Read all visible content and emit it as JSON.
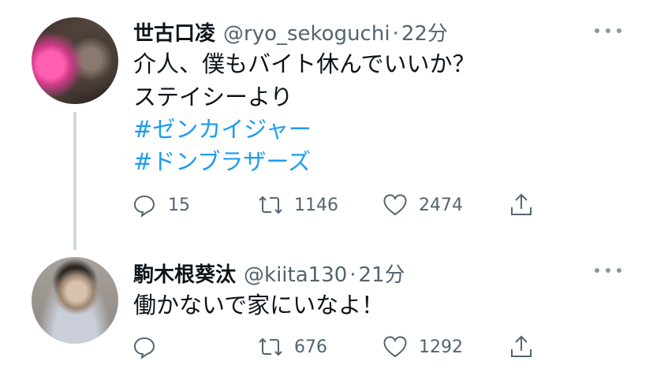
{
  "tweets": [
    {
      "name": "世古口凌",
      "handle": "@ryo_sekoguchi",
      "separator": "·",
      "time": "22分",
      "lines": [
        "介人、僕もバイト休んでいいか？",
        "ステイシーより"
      ],
      "hashtags": [
        "#ゼンカイジャー",
        "#ドンブラザーズ"
      ],
      "reply_count": "15",
      "retweet_count": "1146",
      "like_count": "2474"
    },
    {
      "name": "駒木根葵汰",
      "handle": "@kiita130",
      "separator": "·",
      "time": "21分",
      "lines": [
        "働かないで家にいなよ！"
      ],
      "reply_count": "",
      "retweet_count": "676",
      "like_count": "1292"
    }
  ],
  "icons": {
    "reply": "reply-icon",
    "retweet": "retweet-icon",
    "like": "heart-icon",
    "share": "share-icon",
    "more": "more-icon"
  },
  "colors": {
    "hashtag": "#1d9bf0",
    "secondary_text": "#536471",
    "thread_line": "#cfd9de"
  }
}
